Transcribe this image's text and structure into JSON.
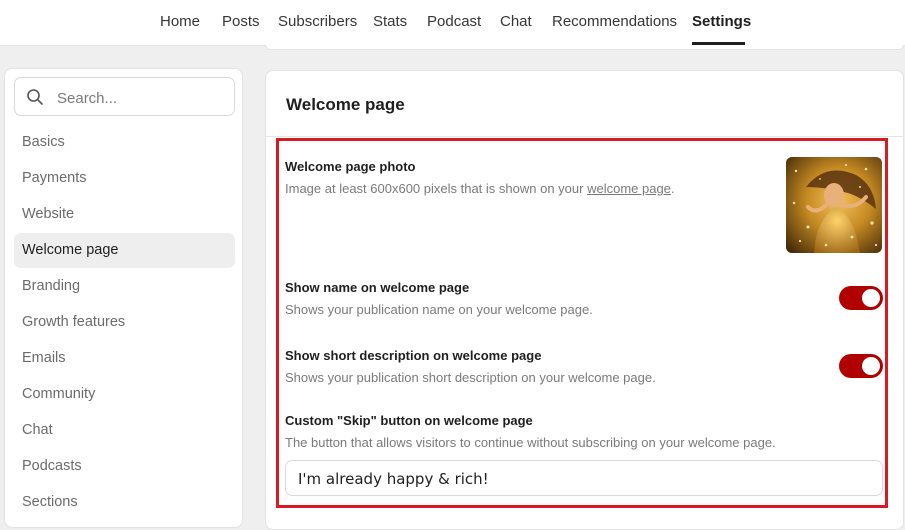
{
  "nav": {
    "tabs": [
      "Home",
      "Posts",
      "Subscribers",
      "Stats",
      "Podcast",
      "Chat",
      "Recommendations",
      "Settings"
    ],
    "active": "Settings"
  },
  "sidebar": {
    "search_placeholder": "Search...",
    "items": [
      "Basics",
      "Payments",
      "Website",
      "Welcome page",
      "Branding",
      "Growth features",
      "Emails",
      "Community",
      "Chat",
      "Podcasts",
      "Sections"
    ],
    "active": "Welcome page"
  },
  "panel": {
    "title": "Welcome page",
    "photo": {
      "title": "Welcome page photo",
      "desc_prefix": "Image at least 600x600 pixels that is shown on your ",
      "desc_link": "welcome page",
      "desc_suffix": "."
    },
    "show_name": {
      "title": "Show name on welcome page",
      "desc": "Shows your publication name on your welcome page.",
      "enabled": true
    },
    "show_description": {
      "title": "Show short description on welcome page",
      "desc": "Shows your publication short description on your welcome page.",
      "enabled": true
    },
    "skip_button": {
      "title": "Custom \"Skip\" button on welcome page",
      "desc": "The button that allows visitors to continue without subscribing on your welcome page.",
      "value": "I'm already happy & rich!"
    }
  },
  "colors": {
    "toggle_on": "#b00000",
    "highlight": "#d81b22",
    "active_nav_bg": "#eeeeee"
  }
}
